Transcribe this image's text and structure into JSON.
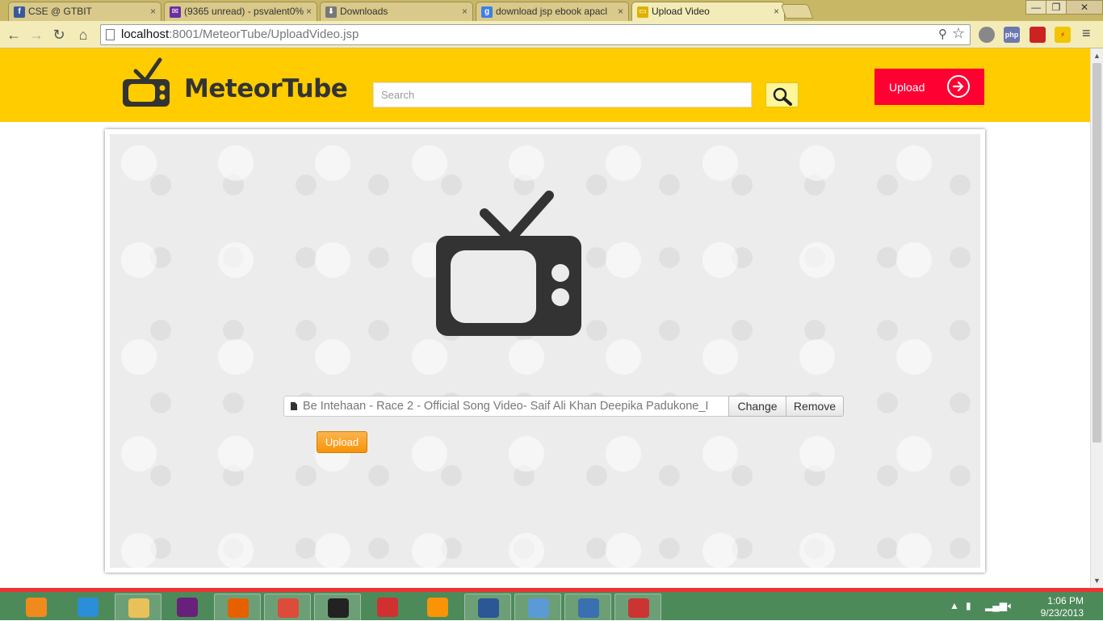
{
  "browser": {
    "tabs": [
      {
        "title": "CSE @ GTBIT",
        "icon": "facebook-icon",
        "color": "#3b5998",
        "glyph": "f"
      },
      {
        "title": "(9365 unread) - psvalent0%",
        "icon": "yahoo-mail-icon",
        "color": "#6b2fa0",
        "glyph": "✉"
      },
      {
        "title": "Downloads",
        "icon": "download-icon",
        "color": "#777777",
        "glyph": "⬇"
      },
      {
        "title": "download jsp ebook apacl",
        "icon": "google-icon",
        "color": "#3f7fe6",
        "glyph": "g"
      },
      {
        "title": "Upload Video",
        "icon": "tv-icon",
        "color": "#e0b000",
        "glyph": "▭"
      }
    ],
    "url_host": "localhost",
    "url_rest": ":8001/MeteorTube/UploadVideo.jsp",
    "window_controls": {
      "minimize": "—",
      "maximize": "❐",
      "close": "✕"
    }
  },
  "site": {
    "brand": "MeteorTube",
    "search_placeholder": "Search",
    "header_upload_label": "Upload",
    "accent_color": "#ffcc00",
    "upload_button_color": "#ff0033"
  },
  "uploader": {
    "file_name": "Be Intehaan - Race 2 - Official Song Video- Saif Ali Khan Deepika Padukone_I",
    "change_label": "Change",
    "remove_label": "Remove",
    "upload_label": "Upload"
  },
  "taskbar": {
    "apps": [
      {
        "name": "media-player",
        "color": "#f08a1c",
        "open": false
      },
      {
        "name": "internet-explorer",
        "color": "#2a8fd8",
        "open": false
      },
      {
        "name": "file-explorer",
        "color": "#e8c15a",
        "open": true
      },
      {
        "name": "visual-studio",
        "color": "#68217a",
        "open": false
      },
      {
        "name": "firefox",
        "color": "#e66000",
        "open": true
      },
      {
        "name": "chrome",
        "color": "#dd4b39",
        "open": true
      },
      {
        "name": "mysql-console",
        "color": "#222222",
        "open": true
      },
      {
        "name": "app-grid",
        "color": "#d03030",
        "open": false
      },
      {
        "name": "xampp",
        "color": "#f89406",
        "open": false
      },
      {
        "name": "word",
        "color": "#2b5797",
        "open": true
      },
      {
        "name": "photo-viewer",
        "color": "#5a9bd5",
        "open": true
      },
      {
        "name": "virtualbox",
        "color": "#3a6fb0",
        "open": true
      },
      {
        "name": "snipping-tool",
        "color": "#cc3333",
        "open": true
      }
    ],
    "time": "1:06 PM",
    "date": "9/23/2013"
  }
}
